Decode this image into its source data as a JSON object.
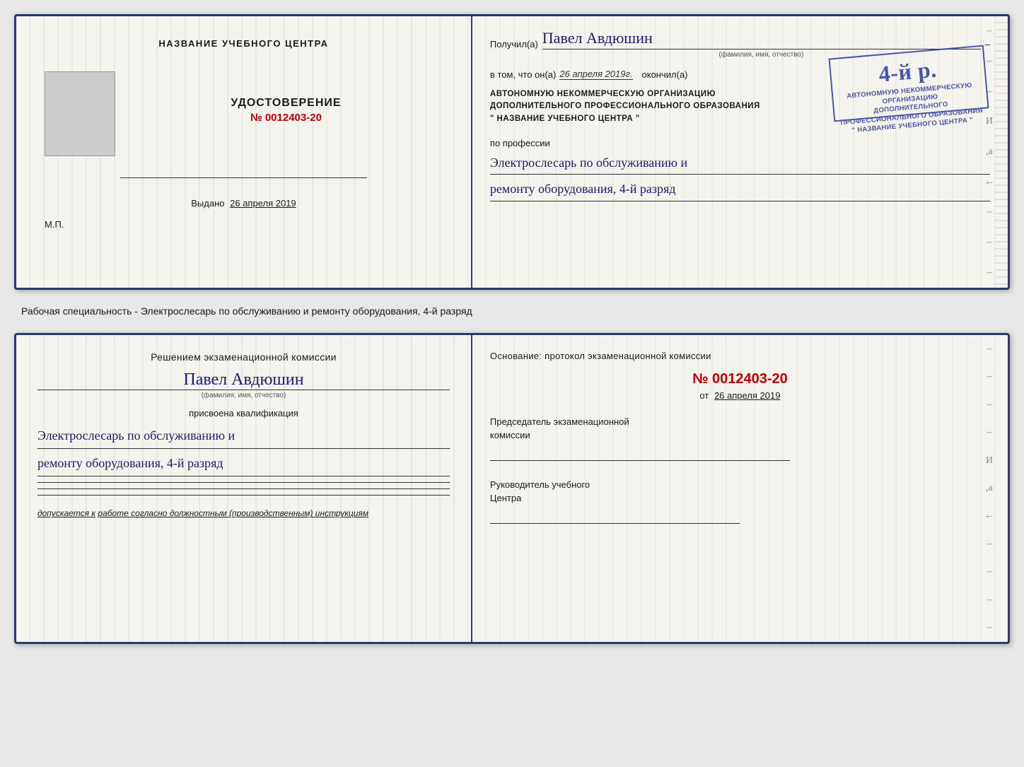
{
  "topDoc": {
    "left": {
      "centerTitle": "НАЗВАНИЕ УЧЕБНОГО ЦЕНТРА",
      "photoAlt": "фото",
      "udostoverenie": "УДОСТОВЕРЕНИЕ",
      "number": "№ 0012403-20",
      "vydanoLabel": "Выдано",
      "vydanoDate": "26 апреля 2019",
      "mp": "М.П."
    },
    "right": {
      "poluchilLabel": "Получил(а)",
      "name": "Павел Авдюшин",
      "nameCaption": "(фамилия, имя, отчество)",
      "dash": "–",
      "vtomLabel": "в том, что он(а)",
      "date": "26 апреля 2019г.",
      "okonchilLabel": "окончил(а)",
      "stampGrade": "4-й р.",
      "stampLine1": "АВТОНОМНУЮ НЕКОММЕРЧЕСКУЮ ОРГАНИЗАЦИЮ",
      "stampLine2": "ДОПОЛНИТЕЛЬНОГО ПРОФЕССИОНАЛЬНОГО ОБРАЗОВАНИЯ",
      "stampLine3": "\" НАЗВАНИЕ УЧЕБНОГО ЦЕНТРА \"",
      "orgLine1": "АВТОНОМНУЮ НЕКОММЕРЧЕСКУЮ ОРГАНИЗАЦИЮ",
      "orgLine2": "ДОПОЛНИТЕЛЬНОГО ПРОФЕССИОНАЛЬНОГО ОБРАЗОВАНИЯ",
      "orgLine3": "\" НАЗВАНИЕ УЧЕБНОГО ЦЕНТРА \"",
      "poProfessii": "по профессии",
      "profession1": "Электрослесарь по обслуживанию и",
      "profession2": "ремонту оборудования, 4-й разряд"
    }
  },
  "middleText": "Рабочая специальность - Электрослесарь по обслуживанию и ремонту оборудования, 4-й разряд",
  "bottomDoc": {
    "left": {
      "resheniyemLabel": "Решением экзаменационной комиссии",
      "name": "Павел Авдюшин",
      "nameCaption": "(фамилия, имя, отчество)",
      "prisvoyenaLabel": "присвоена квалификация",
      "qual1": "Электрослесарь по обслуживанию и",
      "qual2": "ремонту оборудования, 4-й разряд",
      "dopuskaetsyaLabel": "допускается к",
      "dopuskaetsyaValue": "работе согласно должностным (производственным) инструкциям"
    },
    "right": {
      "osnovanieLabelLine1": "Основание: протокол экзаменационной комиссии",
      "protocolNum": "№ 0012403-20",
      "otLabel": "от",
      "otDate": "26 апреля 2019",
      "chairmanLine1": "Председатель экзаменационной",
      "chairmanLine2": "комиссии",
      "rukovoditelLine1": "Руководитель учебного",
      "rukovoditelLine2": "Центра"
    }
  },
  "sideMarks": {
    "right": [
      "–",
      "–",
      "–",
      "–",
      "–",
      "И",
      ",а",
      "←",
      "–",
      "–",
      "–",
      "–"
    ],
    "rightBottom": [
      "–",
      "–",
      "–",
      "–",
      "И",
      ",а",
      "←",
      "–",
      "–",
      "–",
      "–",
      "–"
    ]
  }
}
